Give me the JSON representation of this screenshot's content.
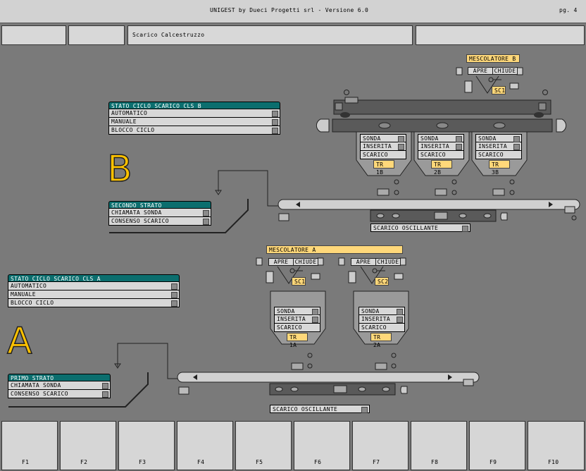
{
  "header": {
    "title": "UNIGEST  by Dueci Progetti srl - Versione 6.0",
    "page": "pg. 4",
    "field_title": "Scarico Calcestruzzo"
  },
  "section_b": {
    "letter": "B",
    "ciclo_title": "STATO CICLO SCARICO CLS B",
    "ciclo_items": [
      "AUTOMATICO",
      "MANUALE",
      "BLOCCO CICLO"
    ],
    "strato_title": "SECONDO STRATO",
    "strato_items": [
      "CHIAMATA SONDA",
      "CONSENSO SCARICO"
    ],
    "mixer_label": "MESCOLATORE B",
    "apre": "APRE",
    "chiude": "CHIUDE",
    "sc": "SC1",
    "hoppers": [
      {
        "sonda": "SONDA",
        "inserita": "INSERITA",
        "scarico": "SCARICO",
        "tr": "TR 1B"
      },
      {
        "sonda": "SONDA",
        "inserita": "INSERITA",
        "scarico": "SCARICO",
        "tr": "TR 2B"
      },
      {
        "sonda": "SONDA",
        "inserita": "INSERITA",
        "scarico": "SCARICO",
        "tr": "TR 3B"
      }
    ],
    "oscillante": "SCARICO OSCILLANTE"
  },
  "section_a": {
    "letter": "A",
    "ciclo_title": "STATO CICLO SCARICO CLS A",
    "ciclo_items": [
      "AUTOMATICO",
      "MANUALE",
      "BLOCCO CICLO"
    ],
    "strato_title": "PRIMO STRATO",
    "strato_items": [
      "CHIAMATA SONDA",
      "CONSENSO SCARICO"
    ],
    "mixer_label": "MESCOLATORE A",
    "apre": "APRE",
    "chiude": "CHIUDE",
    "sc1": "SC1",
    "sc2": "SC2",
    "hoppers": [
      {
        "sonda": "SONDA",
        "inserita": "INSERITA",
        "scarico": "SCARICO",
        "tr": "TR 1A"
      },
      {
        "sonda": "SONDA",
        "inserita": "INSERITA",
        "scarico": "SCARICO",
        "tr": "TR 2A"
      }
    ],
    "oscillante": "SCARICO OSCILLANTE"
  },
  "fkeys": [
    "F1",
    "F2",
    "F3",
    "F4",
    "F5",
    "F6",
    "F7",
    "F8",
    "F9",
    "F10"
  ]
}
